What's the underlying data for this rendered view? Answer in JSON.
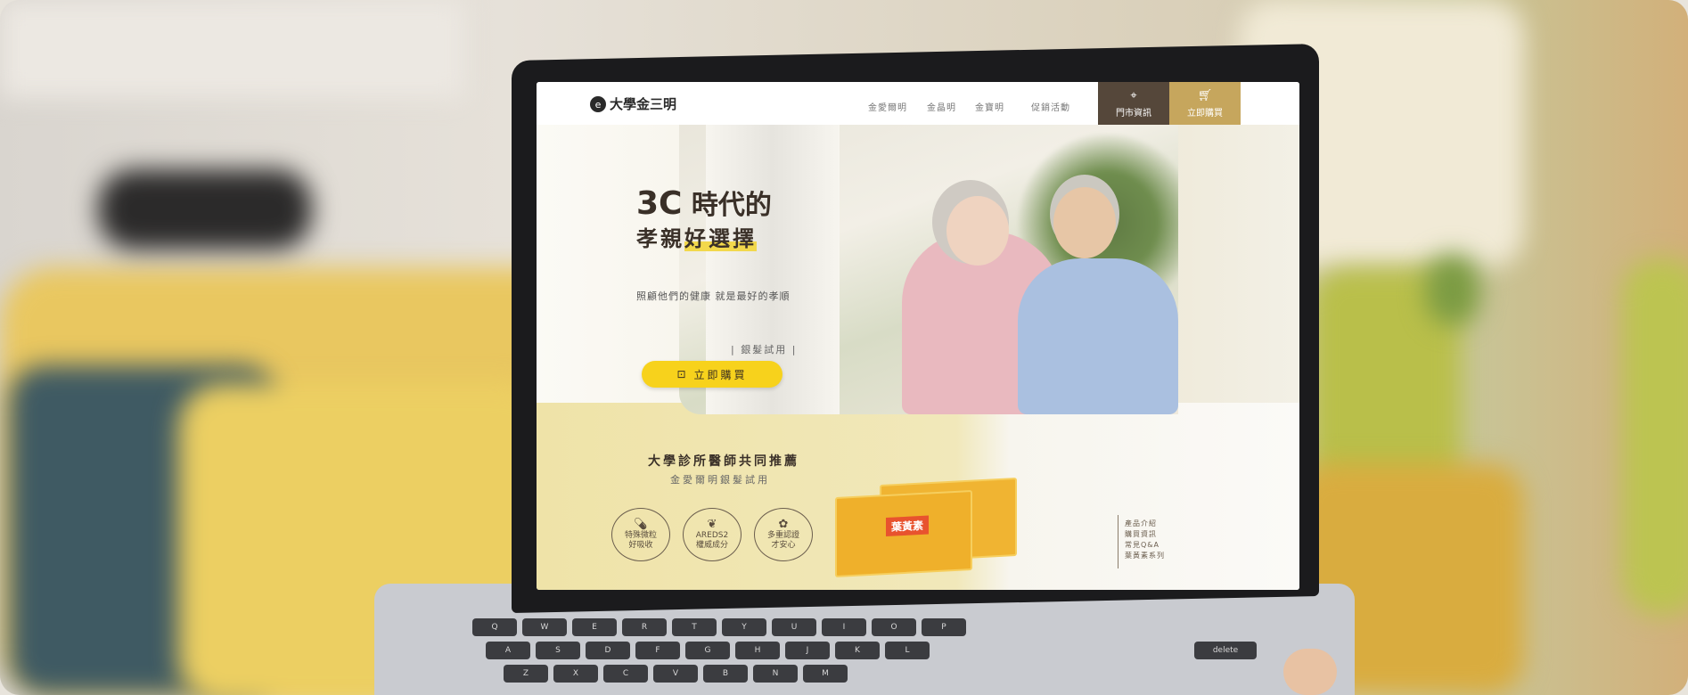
{
  "site": {
    "logo_mark": "e",
    "logo_text": "大學金三明",
    "nav": [
      "金愛爾明",
      "金晶明",
      "金寶明",
      "促銷活動"
    ],
    "store_button": "門市資訊",
    "buy_button": "立即購買"
  },
  "hero": {
    "headline_prefix": "3C",
    "headline_rest": " 時代的",
    "headline_line2_a": "孝親",
    "headline_line2_b": "好選擇",
    "subline": "照顧他們的健康 就是最好的孝順",
    "trial_text": "| 銀髮試用 |",
    "cta": "立即購買"
  },
  "recommend": {
    "title": "大學診所醫師共同推薦",
    "subtitle": "金愛爾明銀髮試用",
    "features": [
      {
        "icon": "capsule-icon",
        "text1": "特殊微粒",
        "text2": "好吸收"
      },
      {
        "icon": "hand-leaf-icon",
        "text1": "AREDS2",
        "text2": "權威成分"
      },
      {
        "icon": "flower-icon",
        "text1": "多重認證",
        "text2": "才安心"
      }
    ],
    "product_label": "葉黃素",
    "side_nav": [
      "產品介紹",
      "購買資訊",
      "常見Q&A",
      "葉黃素系列"
    ]
  },
  "keyboard": {
    "keys": [
      "Q",
      "W",
      "E",
      "R",
      "T",
      "Y",
      "U",
      "I",
      "O",
      "P",
      "A",
      "S",
      "D",
      "F",
      "G",
      "H",
      "J",
      "K",
      "L",
      "Z",
      "X",
      "C",
      "V",
      "B",
      "N",
      "M",
      "delete"
    ]
  }
}
